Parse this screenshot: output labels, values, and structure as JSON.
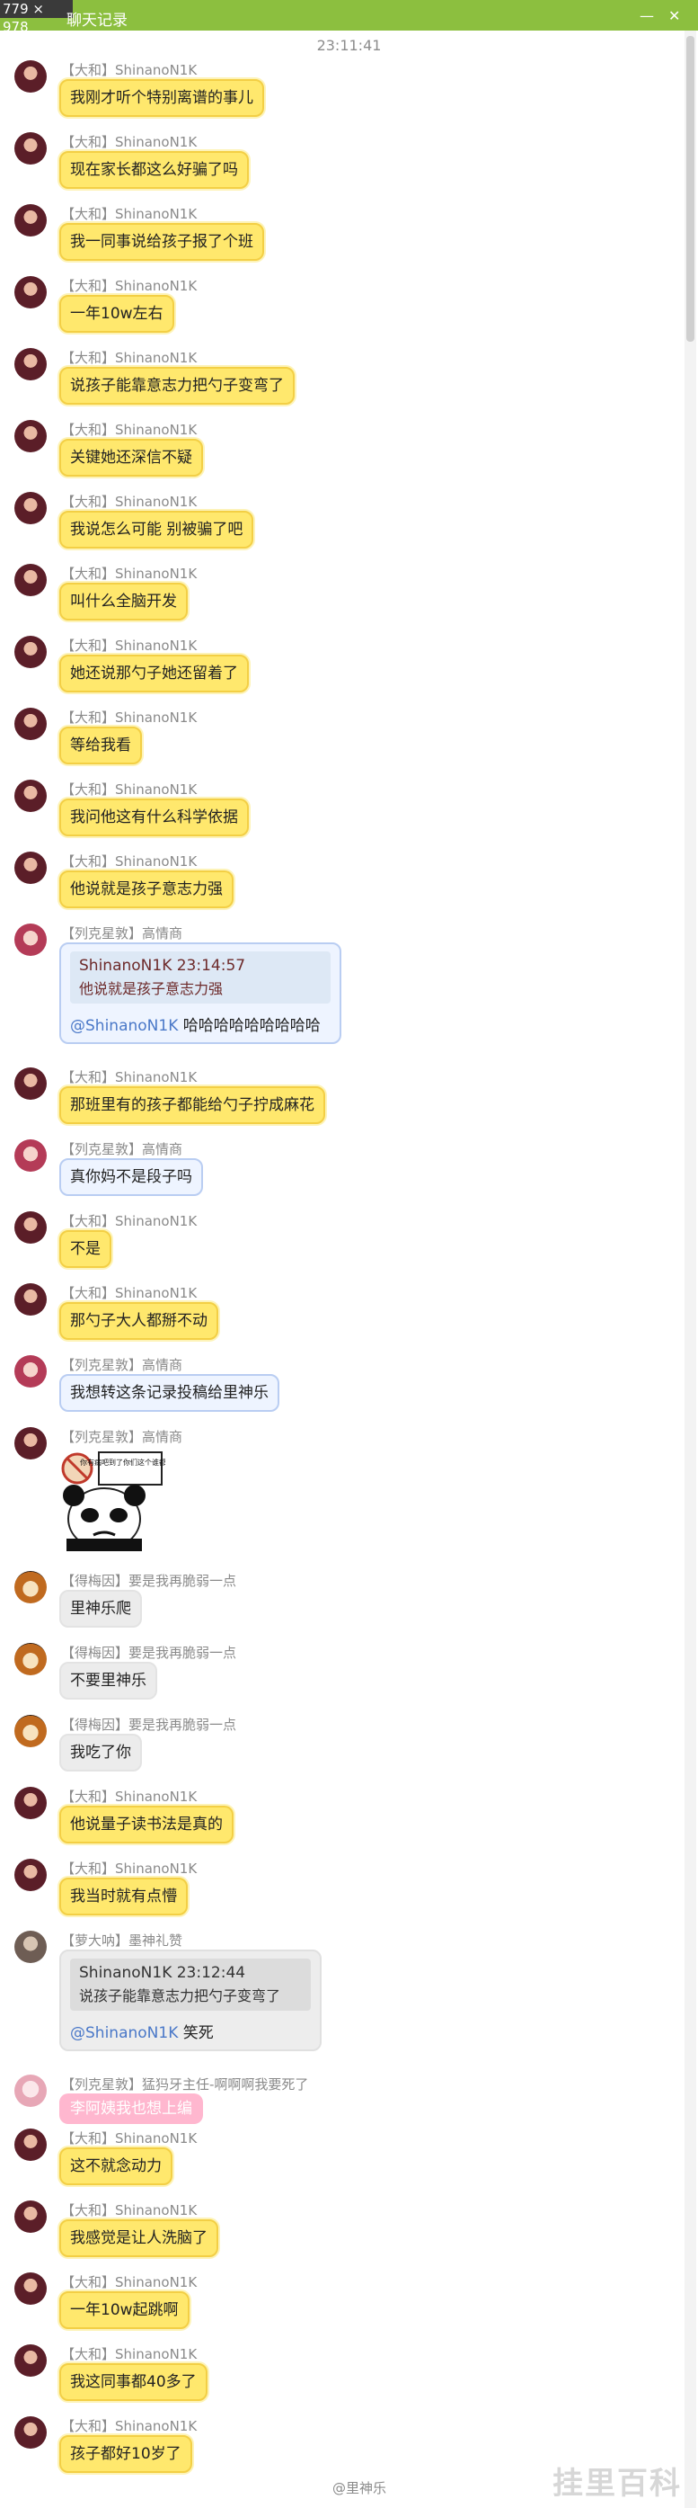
{
  "window": {
    "dimensions_badge": "779 × 978",
    "title": "聊天记录"
  },
  "timestamp": "23:11:41",
  "messages": [
    {
      "sender": "【大和】ShinanoN1K",
      "text": "我刚才听个特别离谱的事儿"
    },
    {
      "sender": "【大和】ShinanoN1K",
      "text": "现在家长都这么好骗了吗"
    },
    {
      "sender": "【大和】ShinanoN1K",
      "text": "我一同事说给孩子报了个班"
    },
    {
      "sender": "【大和】ShinanoN1K",
      "text": "一年10w左右"
    },
    {
      "sender": "【大和】ShinanoN1K",
      "text": "说孩子能靠意志力把勺子变弯了"
    },
    {
      "sender": "【大和】ShinanoN1K",
      "text": "关键她还深信不疑"
    },
    {
      "sender": "【大和】ShinanoN1K",
      "text": "我说怎么可能 别被骗了吧"
    },
    {
      "sender": "【大和】ShinanoN1K",
      "text": "叫什么全脑开发"
    },
    {
      "sender": "【大和】ShinanoN1K",
      "text": "她还说那勺子她还留着了"
    },
    {
      "sender": "【大和】ShinanoN1K",
      "text": "等给我看"
    },
    {
      "sender": "【大和】ShinanoN1K",
      "text": "我问他这有什么科学依据"
    },
    {
      "sender": "【大和】ShinanoN1K",
      "text": "他说就是孩子意志力强"
    },
    {
      "sender": "【列克星敦】高情商",
      "quote_head": "ShinanoN1K   23:14:57",
      "quote_text": "他说就是孩子意志力强",
      "mention": "@ShinanoN1K",
      "reply": " 哈哈哈哈哈哈哈哈哈"
    },
    {
      "sender": "【大和】ShinanoN1K",
      "text": "那班里有的孩子都能给勺子拧成麻花"
    },
    {
      "sender": "【列克星敦】高情商",
      "text": "真你妈不是段子吗"
    },
    {
      "sender": "【大和】ShinanoN1K",
      "text": "不是"
    },
    {
      "sender": "【大和】ShinanoN1K",
      "text": "那勺子大人都掰不动"
    },
    {
      "sender": "【列克星敦】高情商",
      "text": "我想转这条记录投稿给里神乐"
    },
    {
      "sender": "【列克星敦】高情商",
      "sticker_text": "你有病吧到了你们这个谁都知道"
    },
    {
      "sender": "【得梅因】要是我再脆弱一点",
      "text": "里神乐爬"
    },
    {
      "sender": "【得梅因】要是我再脆弱一点",
      "text": "不要里神乐"
    },
    {
      "sender": "【得梅因】要是我再脆弱一点",
      "text": "我吃了你"
    },
    {
      "sender": "【大和】ShinanoN1K",
      "text": "他说量子读书法是真的"
    },
    {
      "sender": "【大和】ShinanoN1K",
      "text": "我当时就有点懵"
    },
    {
      "sender": "【萝大呐】墨神礼赞",
      "quote_head": "ShinanoN1K   23:12:44",
      "quote_text": "说孩子能靠意志力把勺子变弯了",
      "mention": "@ShinanoN1K",
      "reply": " 笑死"
    },
    {
      "sender": "【列克星敦】猛犸牙主任-啊啊啊我要死了",
      "text": "李阿姨我也想上编"
    },
    {
      "sender": "【大和】ShinanoN1K",
      "text": "这不就念动力"
    },
    {
      "sender": "【大和】ShinanoN1K",
      "text": "我感觉是让人洗脑了"
    },
    {
      "sender": "【大和】ShinanoN1K",
      "text": "一年10w起跳啊"
    },
    {
      "sender": "【大和】ShinanoN1K",
      "text": "我这同事都40多了"
    },
    {
      "sender": "【大和】ShinanoN1K",
      "text": "孩子都好10岁了"
    }
  ],
  "footer": {
    "weibo_handle": "@里神乐",
    "watermark": "挂里百科"
  }
}
